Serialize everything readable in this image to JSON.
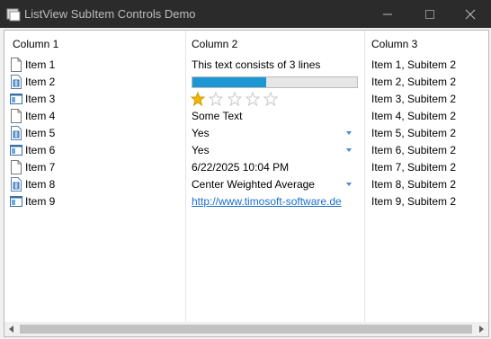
{
  "window": {
    "title": "ListView SubItem Controls Demo"
  },
  "columns": [
    "Column 1",
    "Column 2",
    "Column 3"
  ],
  "rows": [
    {
      "item": "Item 1",
      "icon": "document-icon",
      "col2": "This text consists of 3 lines",
      "col3": "Item 1, Subitem 2"
    },
    {
      "item": "Item 2",
      "icon": "archive-document-icon",
      "col2_progress": 0.45,
      "col3": "Item 2, Subitem 2"
    },
    {
      "item": "Item 3",
      "icon": "window-icon",
      "col2_rating": {
        "value": 1,
        "max": 5
      },
      "col3": "Item 3, Subitem 2"
    },
    {
      "item": "Item 4",
      "icon": "document-icon",
      "col2": "Some Text",
      "col3": "Item 4, Subitem 2"
    },
    {
      "item": "Item 5",
      "icon": "archive-document-icon",
      "col2": "Yes",
      "col2_dropdown": true,
      "col3": "Item 5, Subitem 2"
    },
    {
      "item": "Item 6",
      "icon": "window-icon",
      "col2": "Yes",
      "col2_dropdown": true,
      "col3": "Item 6, Subitem 2"
    },
    {
      "item": "Item 7",
      "icon": "document-icon",
      "col2": "6/22/2025 10:04 PM",
      "col3": "Item 7, Subitem 2"
    },
    {
      "item": "Item 8",
      "icon": "archive-document-icon",
      "col2": "Center Weighted Average",
      "col2_dropdown": true,
      "col3": "Item 8, Subitem 2"
    },
    {
      "item": "Item 9",
      "icon": "window-icon",
      "col2_link": "http://www.timosoft-software.de",
      "col3": "Item 9, Subitem 2"
    }
  ],
  "colors": {
    "progress": "#1c97d4",
    "star": "#f2b705",
    "link": "#1a6fcf"
  }
}
